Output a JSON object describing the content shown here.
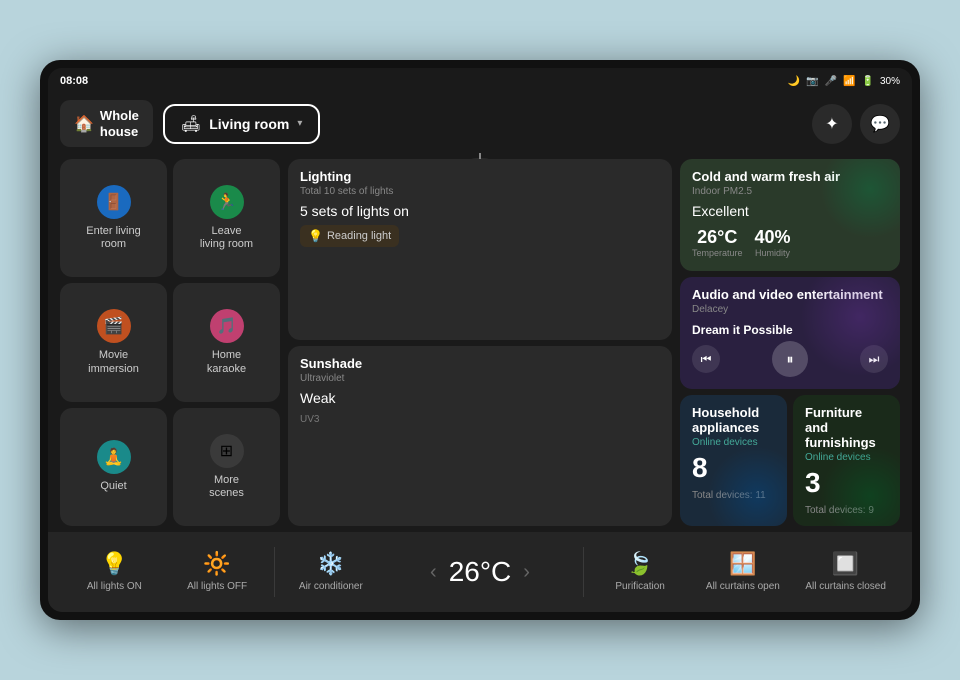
{
  "status_bar": {
    "time": "08:08",
    "battery": "30%"
  },
  "nav": {
    "whole_house_label": "Whole\nhouse",
    "living_room_label": "Living room",
    "whole_house_line1": "Whole",
    "whole_house_line2": "house"
  },
  "scenes": [
    {
      "id": "enter-living",
      "label": "Enter living\nroom",
      "icon": "🚪",
      "color_class": "icon-blue"
    },
    {
      "id": "leave-living",
      "label": "Leave\nliving room",
      "icon": "🚪",
      "color_class": "icon-green"
    },
    {
      "id": "movie-immersion",
      "label": "Movie\nimmersion",
      "icon": "🎬",
      "color_class": "icon-orange"
    },
    {
      "id": "home-karaoke",
      "label": "Home\nkaraoke",
      "icon": "🎵",
      "color_class": "icon-pink"
    },
    {
      "id": "quiet",
      "label": "Quiet",
      "icon": "🧘",
      "color_class": "icon-teal"
    },
    {
      "id": "more-scenes",
      "label": "More\nscenes",
      "icon": "⊞",
      "color_class": "icon-gray"
    }
  ],
  "lighting": {
    "title": "Lighting",
    "subtitle": "Total 10 sets of lights",
    "value": "5 sets of lights on",
    "active_light": "Reading light"
  },
  "sunshade": {
    "title": "Sunshade",
    "subtitle": "Ultraviolet",
    "value": "Weak",
    "uv": "UV3"
  },
  "air": {
    "title": "Cold and warm fresh air",
    "subtitle": "Indoor PM2.5",
    "quality": "Excellent",
    "temperature": "26°C",
    "temp_label": "Temperature",
    "humidity": "40%",
    "humidity_label": "Humidity"
  },
  "audio": {
    "title": "Audio and\nvideo entertainment",
    "artist": "Delacey",
    "song": "Dream it Possible"
  },
  "appliances": {
    "title": "Household appliances",
    "online_label": "Online devices",
    "online_count": "8",
    "total_label": "Total devices: 11"
  },
  "furniture": {
    "title": "Furniture and furnishings",
    "online_label": "Online devices",
    "online_count": "3",
    "total_label": "Total devices: 9"
  },
  "bottom_bar": {
    "all_lights_on": "All lights ON",
    "all_lights_off": "All lights OFF",
    "air_conditioner": "Air conditioner",
    "temperature": "26°C",
    "purification": "Purification",
    "all_curtains_open": "All curtains open",
    "all_curtains_closed": "All curtains closed"
  }
}
